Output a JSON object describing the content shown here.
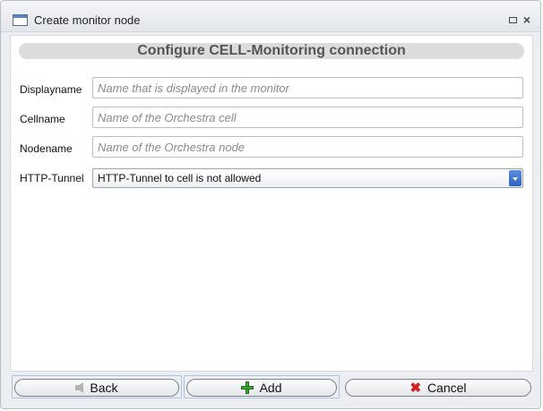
{
  "window": {
    "title": "Create monitor node"
  },
  "dialog": {
    "heading": "Configure CELL-Monitoring connection",
    "fields": [
      {
        "label": "Displayname",
        "value": "",
        "placeholder": "Name that is displayed in the monitor"
      },
      {
        "label": "Cellname",
        "value": "",
        "placeholder": "Name of the Orchestra cell"
      },
      {
        "label": "Nodename",
        "value": "",
        "placeholder": "Name of the Orchestra node"
      }
    ],
    "tunnel": {
      "label": "HTTP-Tunnel",
      "selected": "HTTP-Tunnel to cell is not allowed"
    }
  },
  "buttons": {
    "back": "Back",
    "add": "Add",
    "cancel": "Cancel"
  },
  "icons": {
    "window": "window-icon",
    "restore": "restore-icon",
    "close": "close-icon",
    "back": "back-arrow-icon",
    "add": "plus-icon",
    "cancel": "x-icon"
  }
}
